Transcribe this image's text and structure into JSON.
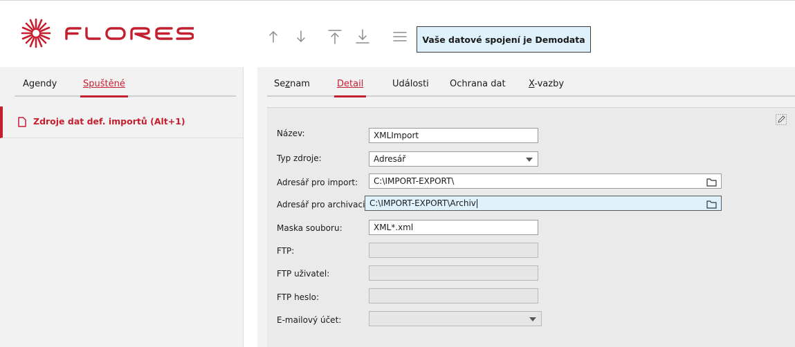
{
  "app": {
    "brand": "FLORES",
    "accent_color": "#c41f2f"
  },
  "toolbar": {
    "buttons": [
      {
        "name": "move-up",
        "icon": "arrow-up-icon"
      },
      {
        "name": "move-down",
        "icon": "arrow-down-icon"
      },
      {
        "name": "move-first",
        "icon": "arrow-first-icon"
      },
      {
        "name": "move-last",
        "icon": "arrow-last-icon"
      },
      {
        "name": "menu",
        "icon": "hamburger-icon"
      }
    ],
    "connection_text": "Vaše datové spojení je Demodata"
  },
  "left_panel": {
    "tabs": [
      {
        "label": "Agendy",
        "active": false
      },
      {
        "label": "Spuštěné",
        "active": true
      }
    ],
    "running_item": {
      "label": "Zdroje dat def. importů (Alt+1)",
      "icon": "document-icon"
    }
  },
  "right_panel": {
    "tabs": [
      {
        "label_pre": "Se",
        "label_ul": "z",
        "label_post": "nam",
        "active": false
      },
      {
        "label_pre": "",
        "label_ul": "D",
        "label_post": "etail",
        "active": true
      },
      {
        "label_pre": "Události",
        "label_ul": "",
        "label_post": "",
        "active": false
      },
      {
        "label_pre": "Ochrana dat",
        "label_ul": "",
        "label_post": "",
        "active": false
      },
      {
        "label_pre": "",
        "label_ul": "X",
        "label_post": "-vazby",
        "active": false
      }
    ],
    "form": {
      "nazev": {
        "label": "Název:",
        "value": "XMLImport"
      },
      "typ_zdroje": {
        "label": "Typ zdroje:",
        "value": "Adresář"
      },
      "adresar_import": {
        "label": "Adresář pro import:",
        "value": "C:\\IMPORT-EXPORT\\"
      },
      "adresar_archivace": {
        "label": "Adresář pro archivaci:",
        "value": "C:\\IMPORT-EXPORT\\Archiv"
      },
      "maska": {
        "label": "Maska souboru:",
        "value": "XML*.xml"
      },
      "ftp": {
        "label": "FTP:",
        "value": ""
      },
      "ftp_uzivatel": {
        "label": "FTP uživatel:",
        "value": ""
      },
      "ftp_heslo": {
        "label": "FTP heslo:",
        "value": ""
      },
      "email_ucet": {
        "label": "E-mailový účet:",
        "value": ""
      }
    }
  }
}
